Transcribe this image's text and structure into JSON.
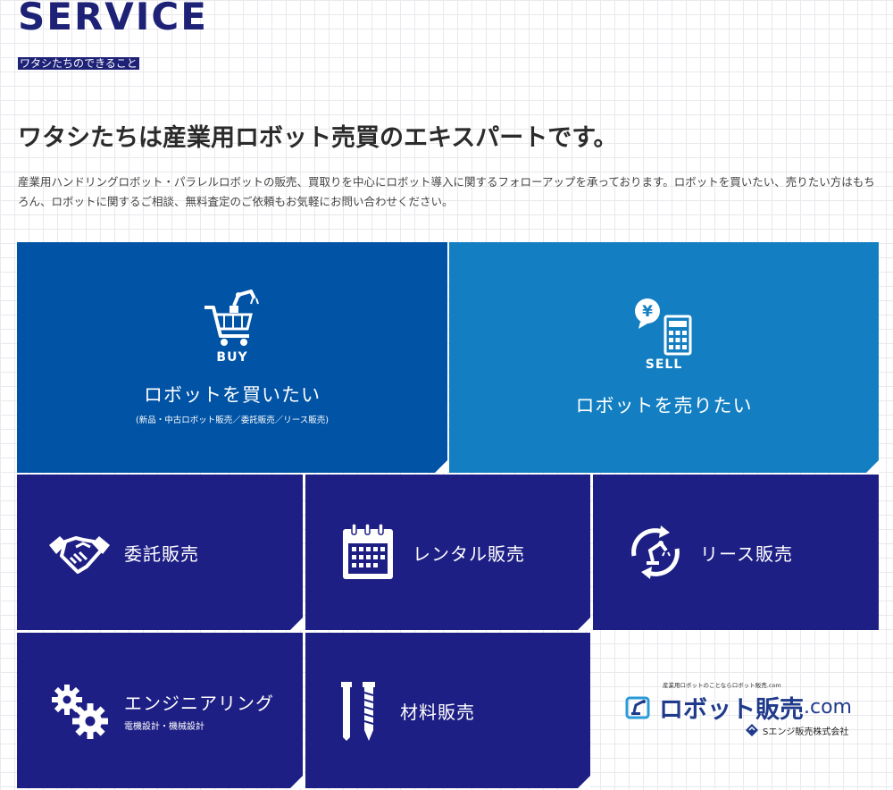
{
  "header": {
    "title": "SERVICE",
    "subtitle": "ワタシたちのできること",
    "headline": "ワタシたちは産業用ロボット売買のエキスパートです。",
    "lead": "産業用ハンドリングロボット・パラレルロボットの販売、買取りを中心にロボット導入に関するフォローアップを承っております。ロボットを買いたい、売りたい方はもちろん、ロボットに関するご相談、無料査定のご依頼もお気軽にお問い合わせください。"
  },
  "tiles": {
    "buy": {
      "tag": "BUY",
      "label": "ロボットを買いたい",
      "note": "(新品・中古ロボット販売／委託販売／リース販売)"
    },
    "sell": {
      "tag": "SELL",
      "label": "ロボットを売りたい"
    },
    "itaku": {
      "label": "委託販売"
    },
    "rental": {
      "label": "レンタル販売"
    },
    "lease": {
      "label": "リース販売"
    },
    "engineering": {
      "label": "エンジニアリング",
      "sub": "電機設計・機械設計"
    },
    "material": {
      "label": "材料販売"
    }
  },
  "logo": {
    "tagline": "産業用ロボットのことならロボット販売.com",
    "name": "ロボット販売",
    "suffix": ".com",
    "company": "Sエンジ販売株式会社"
  },
  "colors": {
    "navy": "#1e1f84",
    "buy_blue": "#0053a5",
    "sell_blue": "#137fc2",
    "title_navy": "#1e2277"
  },
  "icons": [
    "cart-robot-icon",
    "yen-calculator-icon",
    "handshake-icon",
    "calendar-icon",
    "robot-cycle-icon",
    "gears-icon",
    "screw-icon",
    "logo-robot-icon"
  ]
}
